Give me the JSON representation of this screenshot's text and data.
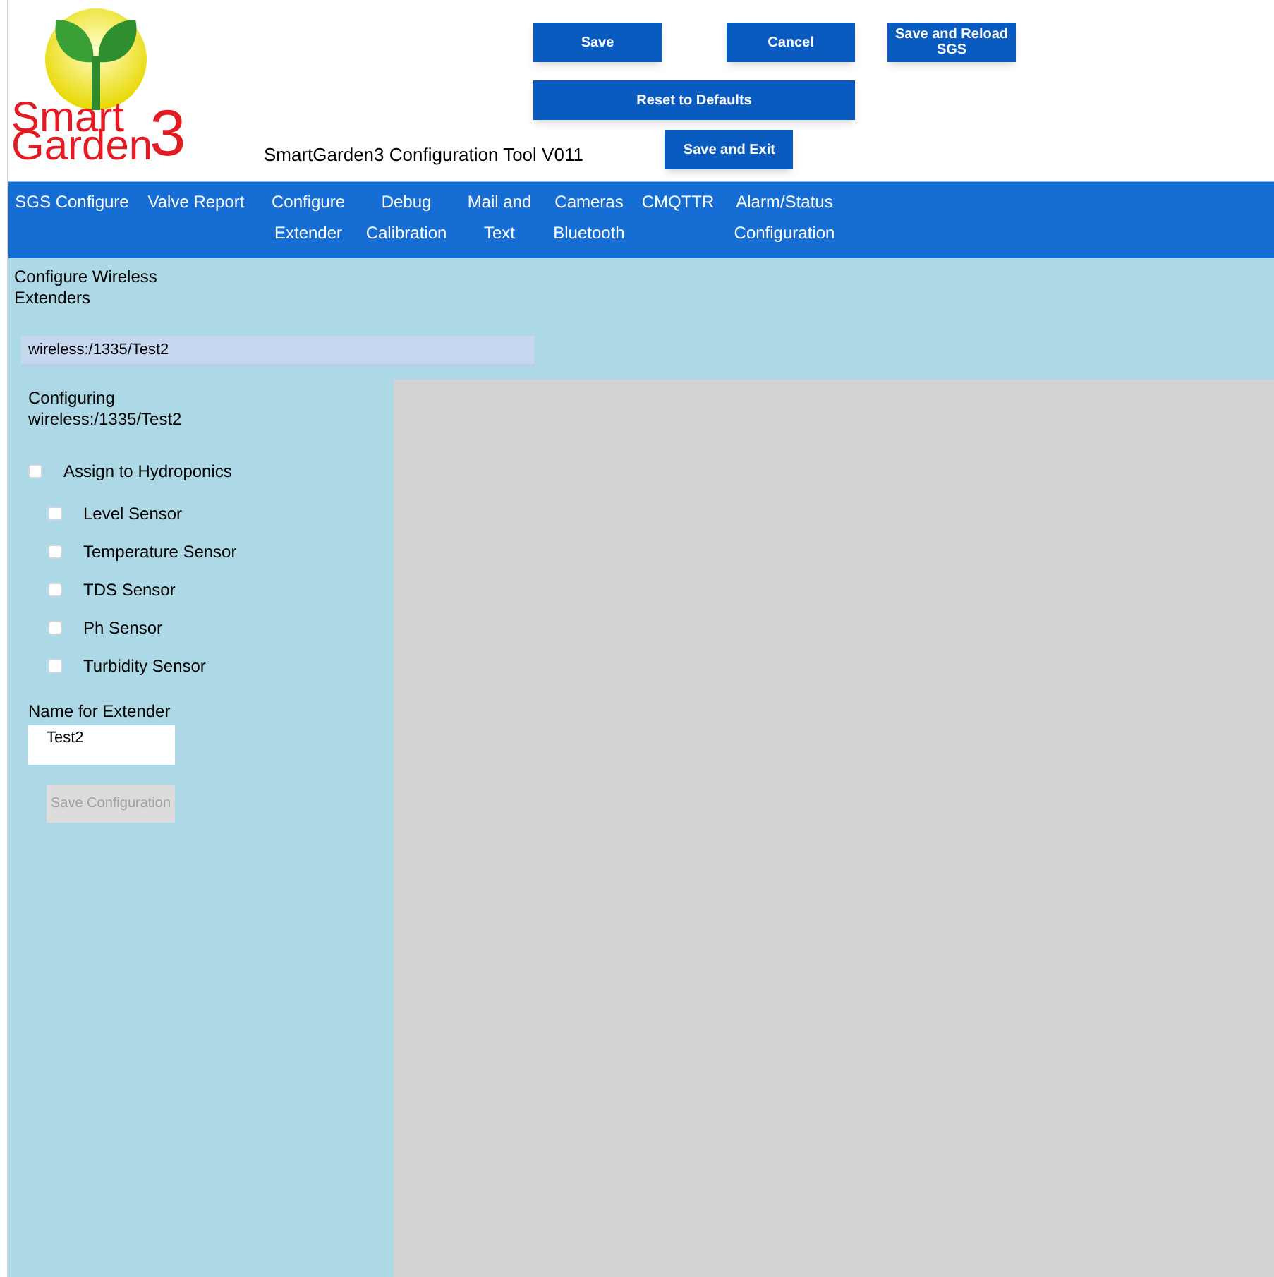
{
  "logo": {
    "line_1": "Smart",
    "line_2": "Garden",
    "digit": "3"
  },
  "title": "SmartGarden3 Configuration Tool V011",
  "buttons": {
    "save": "Save",
    "cancel": "Cancel",
    "save_reload": "Save and Reload SGS",
    "reset": "Reset to Defaults",
    "save_exit": "Save and Exit"
  },
  "nav": [
    {
      "lines": [
        "SGS Configure"
      ]
    },
    {
      "lines": [
        "Valve Report"
      ]
    },
    {
      "lines": [
        "Configure",
        "Extender"
      ]
    },
    {
      "lines": [
        "Debug",
        "Calibration"
      ]
    },
    {
      "lines": [
        "Mail and",
        "Text"
      ]
    },
    {
      "lines": [
        "Cameras",
        "Bluetooth"
      ]
    },
    {
      "lines": [
        "CMQTTR"
      ]
    },
    {
      "lines": [
        "Alarm/Status",
        "Configuration"
      ]
    }
  ],
  "section_title": "Configure Wireless Extenders",
  "extender_list": [
    {
      "label": "wireless:/1335/Test2",
      "selected": true
    }
  ],
  "configuring": "Configuring wireless:/1335/Test2",
  "assign": {
    "label": "Assign to Hydroponics",
    "checked": false
  },
  "sensors": [
    {
      "label": "Level Sensor",
      "checked": false
    },
    {
      "label": "Temperature Sensor",
      "checked": false
    },
    {
      "label": "TDS Sensor",
      "checked": false
    },
    {
      "label": "Ph Sensor",
      "checked": false
    },
    {
      "label": "Turbidity Sensor",
      "checked": false
    }
  ],
  "name_label": "Name for Extender",
  "name_value": "Test2",
  "save_config": {
    "label": "Save Configuration",
    "disabled": true
  }
}
